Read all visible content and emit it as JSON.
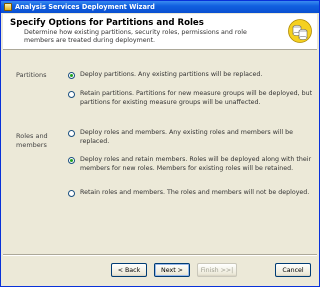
{
  "window": {
    "title": "Analysis Services Deployment Wizard"
  },
  "header": {
    "title": "Specify Options for Partitions and Roles",
    "description": "Determine how existing partitions, security roles, permissions and role members are treated during deployment."
  },
  "partitions": {
    "label": "Partitions",
    "options": [
      {
        "text": "Deploy partitions. Any existing partitions will be replaced.",
        "selected": true
      },
      {
        "text": "Retain partitions. Partitions for new measure groups will be deployed, but partitions for existing measure groups will be unaffected.",
        "selected": false
      }
    ]
  },
  "roles": {
    "label": "Roles and members",
    "options": [
      {
        "text": "Deploy roles and members. Any existing roles and members will be replaced.",
        "selected": false
      },
      {
        "text": "Deploy roles and retain members. Roles will be deployed along with their members for new roles. Members for existing roles will be retained.",
        "selected": true
      },
      {
        "text": "Retain roles and members. The roles and members will not be deployed.",
        "selected": false
      }
    ]
  },
  "buttons": {
    "back": "< Back",
    "next": "Next >",
    "finish": "Finish >>|",
    "cancel": "Cancel"
  },
  "colors": {
    "titlebar": "#0a4fd0",
    "dialog_bg": "#ece9d8",
    "selected_dot": "#21a121"
  }
}
